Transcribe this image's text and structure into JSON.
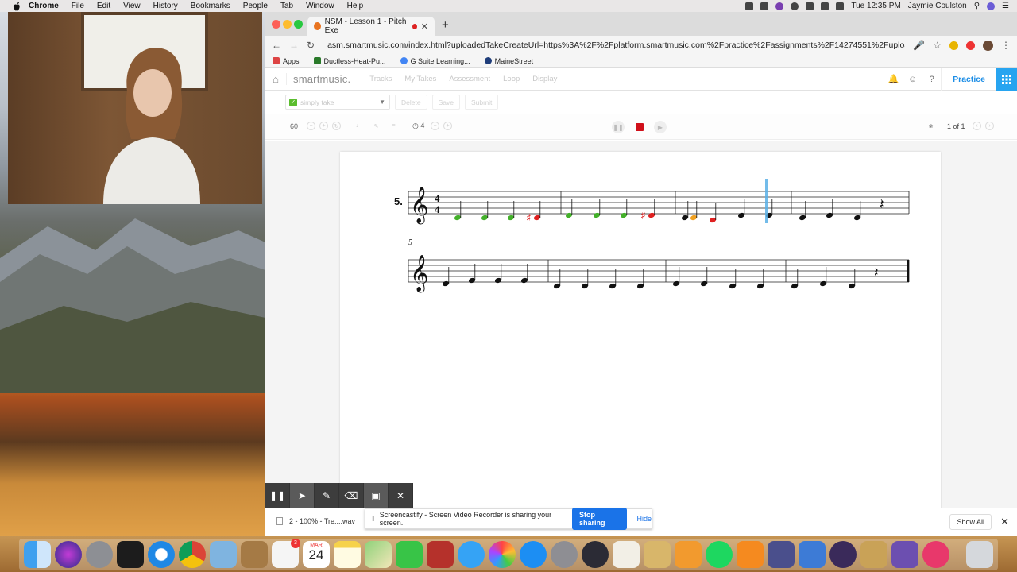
{
  "menubar": {
    "app": "Chrome",
    "items": [
      "File",
      "Edit",
      "View",
      "History",
      "Bookmarks",
      "People",
      "Tab",
      "Window",
      "Help"
    ],
    "clock": "Tue 12:35 PM",
    "user": "Jaymie Coulston"
  },
  "browser": {
    "tab_title": "NSM - Lesson 1 - Pitch Exe",
    "url": "asm.smartmusic.com/index.html?uploadedTakeCreateUrl=https%3A%2F%2Fplatform.smartmusic.com%2Fpractice%2Fassignments%2F14274551%2Fupload...",
    "bookmarks": [
      {
        "label": "Apps",
        "color": "#d44"
      },
      {
        "label": "Ductless-Heat-Pu...",
        "color": "#2a7a2a"
      },
      {
        "label": "G Suite Learning...",
        "color": "#4285f4"
      },
      {
        "label": "MaineStreet",
        "color": "#1f3d7a"
      }
    ]
  },
  "app": {
    "logo": "smartmusic.",
    "nav": [
      "Tracks",
      "My Takes",
      "Assessment",
      "Loop",
      "Display"
    ],
    "practice_label": "Practice",
    "take_select": "simply take",
    "actions": [
      "Delete",
      "Save",
      "Submit"
    ],
    "tempo": "60",
    "count_in": "4",
    "pages": "1 of 1"
  },
  "score": {
    "exercise_number": "5.",
    "time_signature": "4/4",
    "second_system_measure": "5",
    "notes_line1": [
      {
        "color": "#43b02a"
      },
      {
        "color": "#43b02a"
      },
      {
        "color": "#43b02a"
      },
      {
        "color": "#e02020",
        "sharp": true
      },
      {
        "color": "#43b02a"
      },
      {
        "color": "#43b02a"
      },
      {
        "color": "#43b02a"
      },
      {
        "color": "#e02020",
        "sharp": true
      },
      {
        "color": "#111"
      },
      {
        "color": "#f0a020"
      },
      {
        "color": "#e02020"
      },
      {
        "color": "#111"
      },
      {
        "color": "#111"
      },
      {
        "color": "#111"
      },
      {
        "color": "#111"
      },
      {
        "color": "#111"
      }
    ],
    "notes_line2_count": 16,
    "cursor_color": "#5bb0e6"
  },
  "download": {
    "file": "2 - 100% - Tre....wav",
    "show_all": "Show All"
  },
  "screencastify": {
    "message": "Screencastify - Screen Video Recorder is sharing your screen.",
    "stop": "Stop sharing",
    "hide": "Hide"
  },
  "dock": {
    "calendar_month": "MAR",
    "calendar_day": "24",
    "reminders_badge": "3"
  }
}
